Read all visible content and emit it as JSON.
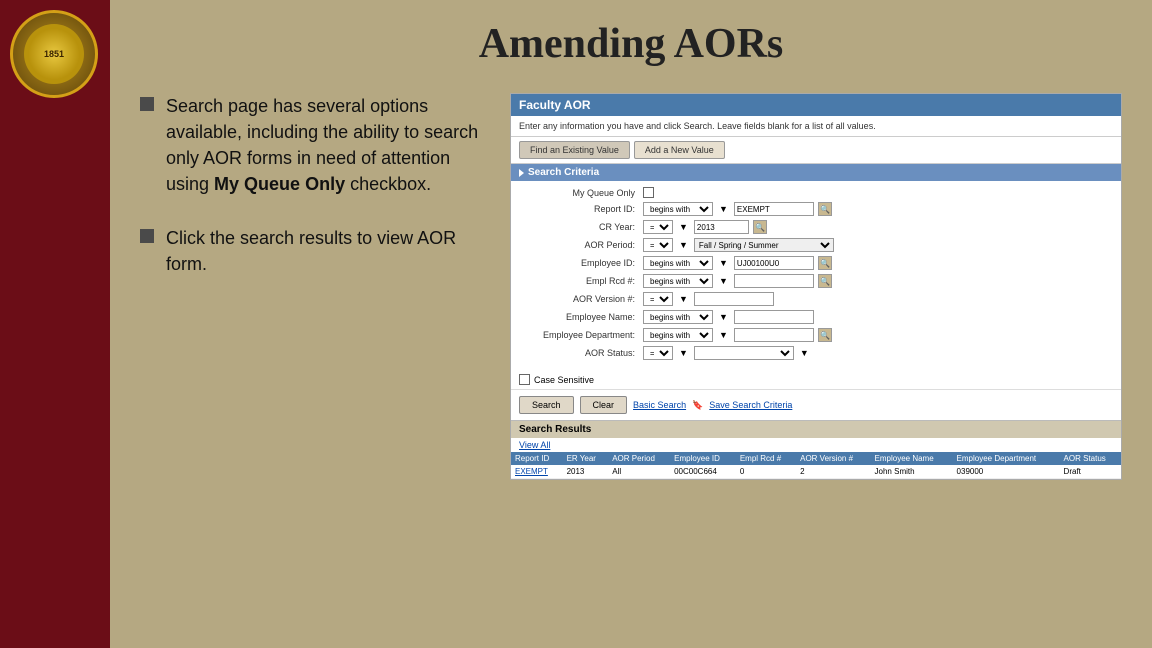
{
  "page": {
    "title": "Amending AORs",
    "background_color": "#b5a882",
    "sidebar_color": "#6b0d17"
  },
  "seal": {
    "year": "1851",
    "name": "FLORIDA STATE UNIVERSITY"
  },
  "bullets": [
    {
      "id": "bullet-1",
      "text_parts": [
        {
          "text": "Search page has several options available, including the ability to search only AOR forms in need of attention using ",
          "bold": false
        },
        {
          "text": "My Queue Only",
          "bold": true
        },
        {
          "text": " checkbox.",
          "bold": false
        }
      ],
      "display": "Search page has several options available, including the ability to search only AOR forms in need of attention using My Queue Only checkbox."
    },
    {
      "id": "bullet-2",
      "text_parts": [
        {
          "text": "Click the search results to view AOR form.",
          "bold": false
        }
      ],
      "display": "Click the search results to view AOR form."
    }
  ],
  "panel": {
    "title": "Faculty AOR",
    "instruction": "Enter any information you have and click Search. Leave fields blank for a list of all values.",
    "tabs": [
      {
        "label": "Find an Existing Value",
        "active": true
      },
      {
        "label": "Add a New Value",
        "active": false
      }
    ],
    "search_criteria_label": "Search Criteria",
    "fields": [
      {
        "label": "My Queue Only",
        "type": "checkbox",
        "checked": false
      },
      {
        "label": "Report ID:",
        "type": "select-input-icon",
        "operator": "begins with",
        "value": "EXEMPT"
      },
      {
        "label": "CR Year:",
        "type": "select-input",
        "operator": "=",
        "value": "2013"
      },
      {
        "label": "AOR Period:",
        "type": "select-period",
        "operator": "=",
        "value": "Fall / Spring / Summer"
      },
      {
        "label": "Employee ID:",
        "type": "select-input-icon",
        "operator": "begins with",
        "value": "UJ00100U0"
      },
      {
        "label": "Empl Rcd #:",
        "type": "select-input-icon",
        "operator": "begins with",
        "value": ""
      },
      {
        "label": "AOR Version #:",
        "type": "select-input",
        "operator": "=",
        "value": ""
      },
      {
        "label": "Employee Name:",
        "type": "select-input",
        "operator": "begins with",
        "value": ""
      },
      {
        "label": "Employee Department:",
        "type": "select-input-icon",
        "operator": "begins with",
        "value": ""
      },
      {
        "label": "AOR Status:",
        "type": "select-dropdown",
        "operator": "=",
        "value": ""
      }
    ],
    "case_sensitive_label": "Case Sensitive",
    "buttons": {
      "search": "Search",
      "clear": "Clear"
    },
    "links": {
      "basic_search": "Basic Search",
      "save_criteria": "Save Search Criteria"
    },
    "results": {
      "header": "Search Results",
      "view_all": "View All",
      "columns": [
        "Report ID",
        "ER Year",
        "AOR Period",
        "Employee ID",
        "Empl Rcd #",
        "AOR Version #",
        "Employee Name",
        "Employee Department",
        "AOR Status"
      ],
      "rows": [
        {
          "report_id": "EXEMPT",
          "er_year": "2013",
          "aor_period": "All",
          "employee_id": "00C00C664",
          "empl_rcd": "0",
          "aor_version": "2",
          "employee_name": "John Smith",
          "employee_dept": "039000",
          "aor_status": "Draft"
        }
      ]
    }
  }
}
